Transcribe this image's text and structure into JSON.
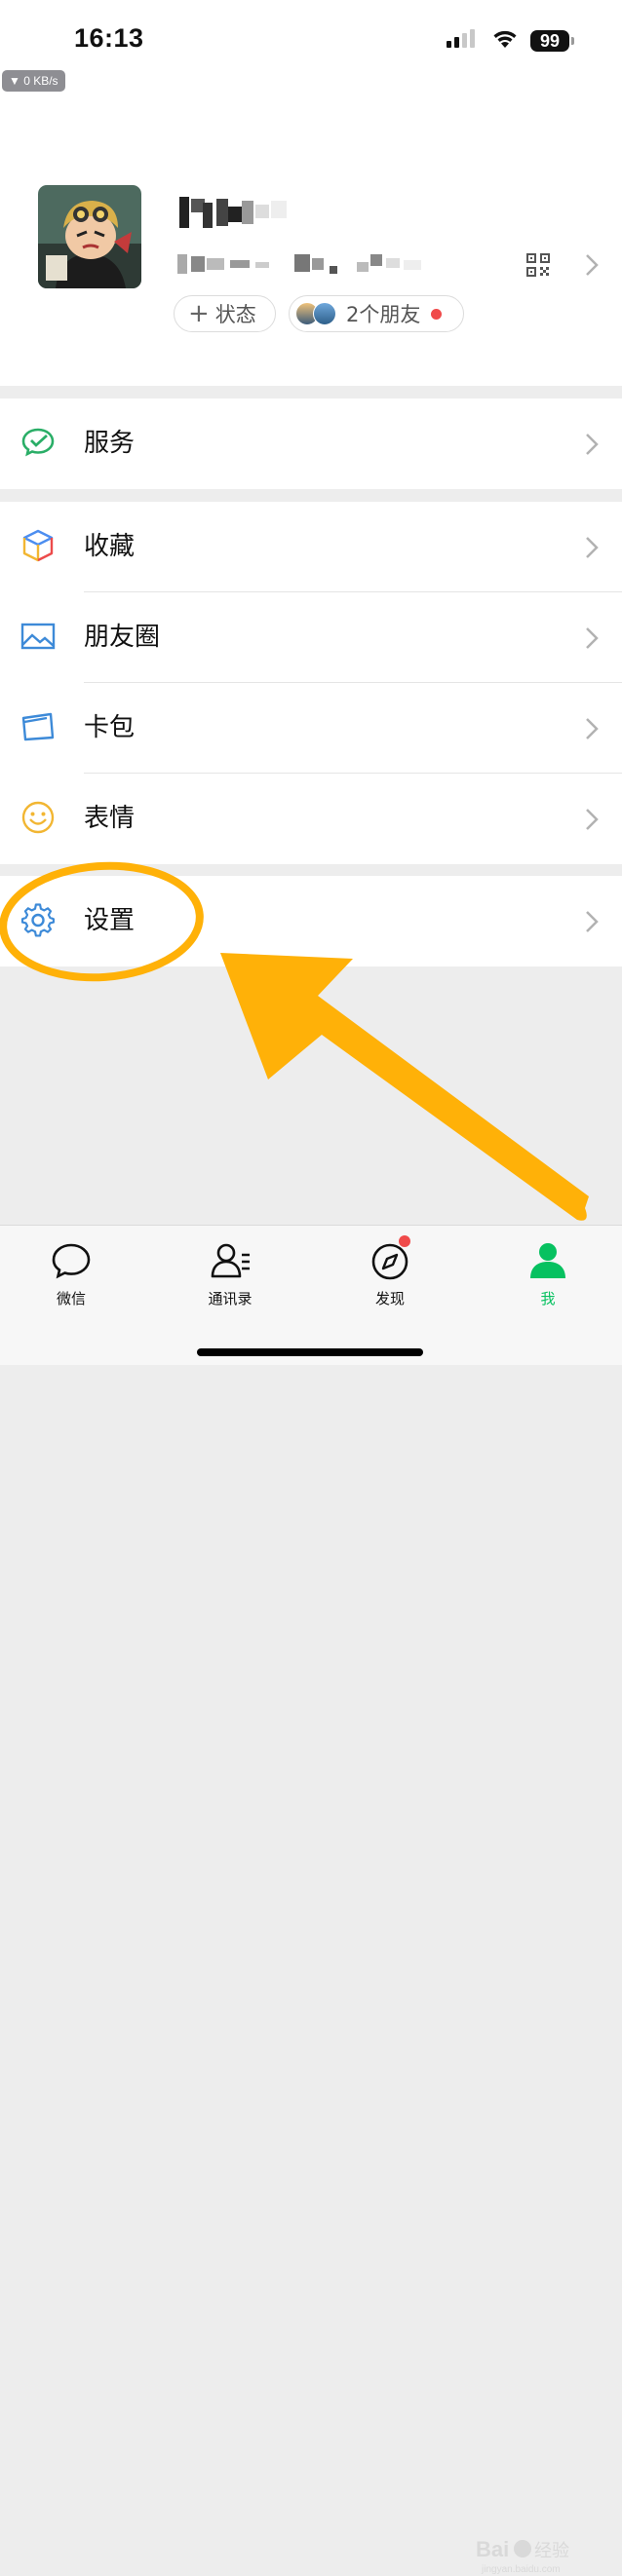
{
  "status_bar": {
    "time": "16:13",
    "battery": "99",
    "net_speed": "▼ 0 KB/s"
  },
  "profile": {
    "status_chip": {
      "plus": "+",
      "label": "状态"
    },
    "friends_chip": {
      "label": "2个朋友"
    }
  },
  "menu": {
    "service": {
      "label": "服务",
      "icon": "wechat-pay-icon"
    },
    "favorites": {
      "label": "收藏",
      "icon": "cube-icon"
    },
    "moments": {
      "label": "朋友圈",
      "icon": "picture-icon"
    },
    "cards": {
      "label": "卡包",
      "icon": "wallet-icon"
    },
    "stickers": {
      "label": "表情",
      "icon": "smile-icon"
    },
    "settings": {
      "label": "设置",
      "icon": "gear-icon"
    }
  },
  "tabbar": {
    "tabs": [
      {
        "label": "微信",
        "icon": "chat-bubble-icon"
      },
      {
        "label": "通讯录",
        "icon": "contacts-icon"
      },
      {
        "label": "发现",
        "icon": "compass-icon"
      },
      {
        "label": "我",
        "icon": "person-icon"
      }
    ]
  },
  "colors": {
    "accent": "#07c160",
    "annotation": "#ffb108",
    "badge": "#f04a4a"
  }
}
